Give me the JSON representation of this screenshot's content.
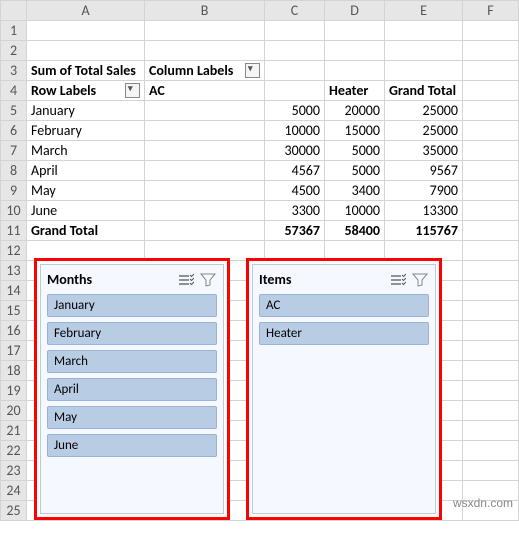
{
  "cols": [
    "",
    "A",
    "B",
    "C",
    "D",
    "E",
    "F"
  ],
  "pivot": {
    "title": "Sum of Total Sales",
    "colLabelsHdr": "Column Labels",
    "rowLabelsHdr": "Row Labels",
    "colHdrs": [
      "AC",
      "Heater",
      "Grand Total"
    ],
    "rows": [
      {
        "r": "5",
        "label": "January",
        "v": [
          "5000",
          "20000",
          "25000"
        ]
      },
      {
        "r": "6",
        "label": "February",
        "v": [
          "10000",
          "15000",
          "25000"
        ]
      },
      {
        "r": "7",
        "label": "March",
        "v": [
          "30000",
          "5000",
          "35000"
        ]
      },
      {
        "r": "8",
        "label": "April",
        "v": [
          "4567",
          "5000",
          "9567"
        ]
      },
      {
        "r": "9",
        "label": "May",
        "v": [
          "4500",
          "3400",
          "7900"
        ]
      },
      {
        "r": "10",
        "label": "June",
        "v": [
          "3300",
          "10000",
          "13300"
        ]
      }
    ],
    "grandTotal": {
      "label": "Grand Total",
      "v": [
        "57367",
        "58400",
        "115767"
      ]
    }
  },
  "slicers": {
    "months": {
      "title": "Months",
      "items": [
        "January",
        "February",
        "March",
        "April",
        "May",
        "June"
      ]
    },
    "items": {
      "title": "Items",
      "items": [
        "AC",
        "Heater"
      ]
    }
  },
  "watermark": "wsxdn.com",
  "blankRows": [
    "1",
    "2",
    "12",
    "13",
    "14",
    "15",
    "16",
    "17",
    "18",
    "19",
    "20",
    "21",
    "22",
    "23",
    "24",
    "25"
  ]
}
